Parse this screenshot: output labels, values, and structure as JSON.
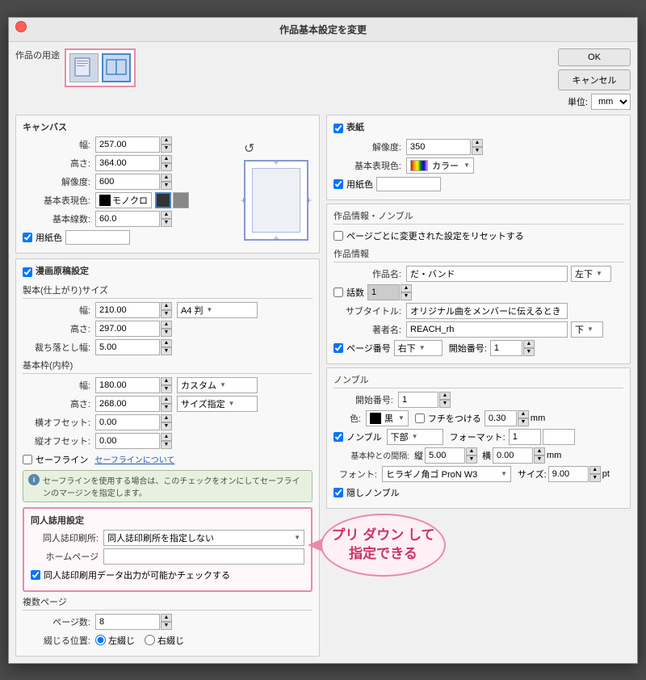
{
  "title": "作品基本設定を変更",
  "close_btn": "×",
  "buttons": {
    "ok": "OK",
    "cancel": "キャンセル",
    "unit_label": "単位:",
    "unit_value": "mm"
  },
  "artwork_purpose_label": "作品の用途",
  "canvas": {
    "title": "キャンバス",
    "width_label": "幅:",
    "width_value": "257.00",
    "height_label": "高さ:",
    "height_value": "364.00",
    "resolution_label": "解像度:",
    "resolution_value": "600",
    "base_color_label": "基本表現色:",
    "base_color_value": "モノクロ",
    "base_lines_label": "基本線数:",
    "base_lines_value": "60.0",
    "paper_color_label": "用紙色"
  },
  "manga": {
    "title": "漫画原稿設定",
    "finished_size_title": "製本(仕上がり)サイズ",
    "width_label": "幅:",
    "width_value": "210.00",
    "size_label": "A4 判",
    "height_label": "高さ:",
    "height_value": "297.00",
    "bleed_label": "裁ち落とし幅:",
    "bleed_value": "5.00",
    "frame_title": "基本枠(内枠)",
    "frame_width_label": "幅:",
    "frame_width_value": "180.00",
    "frame_custom": "カスタム",
    "frame_height_label": "高さ:",
    "frame_height_value": "268.00",
    "frame_size": "サイズ指定",
    "offset_h_label": "横オフセット:",
    "offset_h_value": "0.00",
    "offset_v_label": "縦オフセット:",
    "offset_v_value": "0.00",
    "safeline_label": "セーフライン",
    "safeline_link": "セーフラインについて",
    "safeline_info": "セーフラインを使用する場合は、このチェックをオンにしてセーフラインのマージンを指定します。"
  },
  "cover": {
    "title": "表紙",
    "resolution_label": "解像度:",
    "resolution_value": "350",
    "base_color_label": "基本表現色:",
    "base_color_value": "カラー",
    "paper_color_label": "用紙色"
  },
  "work_info": {
    "section1": "作品情報・ノンブル",
    "reset_pages_label": "ページごとに変更された設定をリセットする",
    "section2": "作品情報",
    "work_name_label": "作品名:",
    "work_name_value": "だ・バンド",
    "work_name_align": "左下",
    "edition_label": "話数",
    "edition_value": "1",
    "subtitle_label": "サブタイトル:",
    "subtitle_value": "オリジナル曲をメンバーに伝えるとき",
    "author_label": "著者名:",
    "author_value": "REACH_rh",
    "author_align": "下",
    "page_number_label": "ページ番号",
    "page_number_pos": "右下",
    "page_number_start_label": "開始番号:",
    "page_number_start": "1"
  },
  "numb": {
    "title": "ノンブル",
    "start_label": "開始番号:",
    "start_value": "1",
    "color_label": "色:",
    "color_value": "黒",
    "border_label": "フチをつける",
    "border_value": "0.30",
    "border_unit": "mm",
    "numb_check": "ノンブル",
    "numb_pos": "下部",
    "format_label": "フォーマット:",
    "format_value": "1",
    "frame_gap_label": "基本枠との間隔:",
    "frame_gap_v_label": "縦",
    "frame_gap_v_value": "5.00",
    "frame_gap_h_label": "横",
    "frame_gap_h_value": "0.00",
    "frame_gap_unit": "mm",
    "font_label": "フォント:",
    "font_value": "ヒラギノ角ゴ ProN W3",
    "size_label": "サイズ:",
    "size_value": "9.00",
    "size_unit": "pt",
    "hide_numb_label": "隠しノンブル"
  },
  "doujin": {
    "title": "同人誌用設定",
    "printer_label": "同人誌印刷所:",
    "printer_value": "同人誌印刷所を指定しない",
    "homepage_label": "ホームページ",
    "check_label": "同人誌印刷用データ出力が可能かチェックする",
    "balloon_text": "プリ ダウン して\n指定できる"
  },
  "pages": {
    "title": "複数ページ",
    "count_label": "ページ数:",
    "count_value": "8",
    "bind_label": "綴じる位置:",
    "bind_left": "左綴じ",
    "bind_right": "右綴じ"
  }
}
